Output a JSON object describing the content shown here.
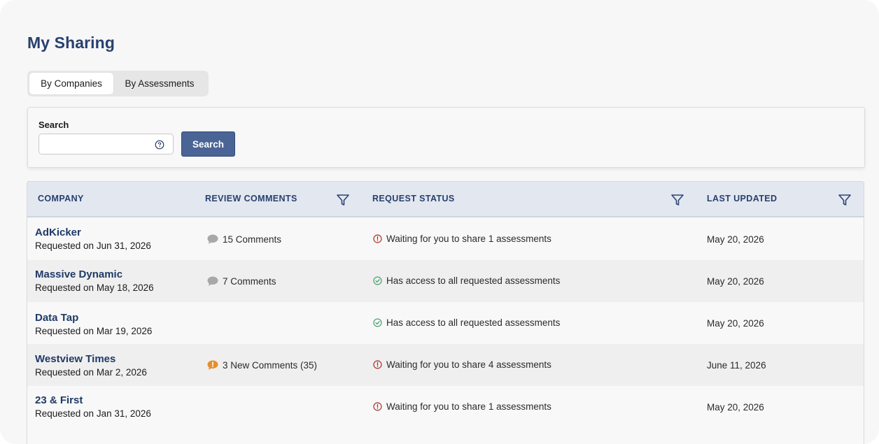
{
  "page": {
    "title": "My Sharing"
  },
  "tabs": [
    {
      "label": "By Companies",
      "active": true
    },
    {
      "label": "By Assessments",
      "active": false
    }
  ],
  "search": {
    "label": "Search",
    "value": "",
    "placeholder": "",
    "button_label": "Search",
    "help_icon": "question-circle-icon"
  },
  "table": {
    "columns": [
      {
        "label": "COMPANY",
        "filterable": false
      },
      {
        "label": "REVIEW COMMENTS",
        "filterable": true
      },
      {
        "label": "REQUEST STATUS",
        "filterable": true
      },
      {
        "label": "LAST UPDATED",
        "filterable": true
      }
    ],
    "rows": [
      {
        "company": "AdKicker",
        "requested": "Requested on Jun 31, 2026",
        "comments": "15 Comments",
        "comment_icon": "speech-bubble-icon",
        "status": "Waiting for you to share 1 assessments",
        "status_icon": "alert-circle-icon",
        "updated": "May 20, 2026"
      },
      {
        "company": "Massive Dynamic",
        "requested": "Requested on May 18, 2026",
        "comments": "7 Comments",
        "comment_icon": "speech-bubble-icon",
        "status": "Has access to all requested assessments",
        "status_icon": "check-circle-icon",
        "updated": "May 20, 2026"
      },
      {
        "company": "Data Tap",
        "requested": "Requested on Mar 19, 2026",
        "comments": "",
        "comment_icon": "",
        "status": "Has access to all requested assessments",
        "status_icon": "check-circle-icon",
        "updated": "May 20, 2026"
      },
      {
        "company": "Westview Times",
        "requested": "Requested on Mar 2, 2026",
        "comments": "3 New Comments (35)",
        "comment_icon": "new-comment-bubble-icon",
        "status": "Waiting for you to share 4 assessments",
        "status_icon": "alert-circle-icon",
        "updated": "June 11, 2026"
      },
      {
        "company": "23 & First",
        "requested": "Requested on Jan 31, 2026",
        "comments": "",
        "comment_icon": "",
        "status": "Waiting for you to share 1 assessments",
        "status_icon": "alert-circle-icon",
        "updated": "May 20, 2026"
      }
    ]
  },
  "colors": {
    "title": "#28406f",
    "header_bg": "#e3e7ef",
    "button_bg": "#4b6496",
    "alert": "#a8322c",
    "success": "#3f9a66",
    "comment_neutral": "#a8a8a8",
    "comment_new": "#e58f2b"
  }
}
